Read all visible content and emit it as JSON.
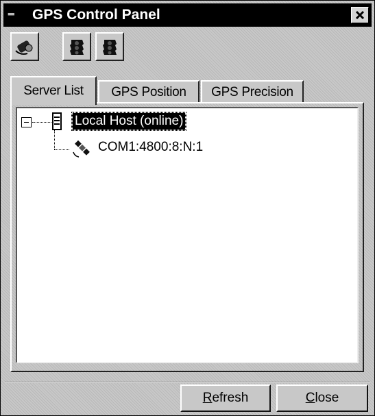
{
  "window": {
    "title": "GPS Control Panel"
  },
  "toolbar": {
    "buttons": [
      {
        "icon": "satellite-connect-icon"
      },
      {
        "icon": "traffic-light-icon"
      },
      {
        "icon": "traffic-light-icon"
      }
    ]
  },
  "tabs": [
    {
      "label": "Server List",
      "active": true
    },
    {
      "label": "GPS Position",
      "active": false
    },
    {
      "label": "GPS Precision",
      "active": false
    }
  ],
  "tree": {
    "root": {
      "label": "Local Host (online)",
      "icon": "server-icon",
      "expanded": true,
      "selected": true
    },
    "children": [
      {
        "label": "COM1:4800:8:N:1",
        "icon": "satellite-icon"
      }
    ]
  },
  "buttons": {
    "refresh": {
      "mnemonic": "R",
      "rest": "efresh"
    },
    "close": {
      "mnemonic": "C",
      "rest": "lose"
    }
  }
}
